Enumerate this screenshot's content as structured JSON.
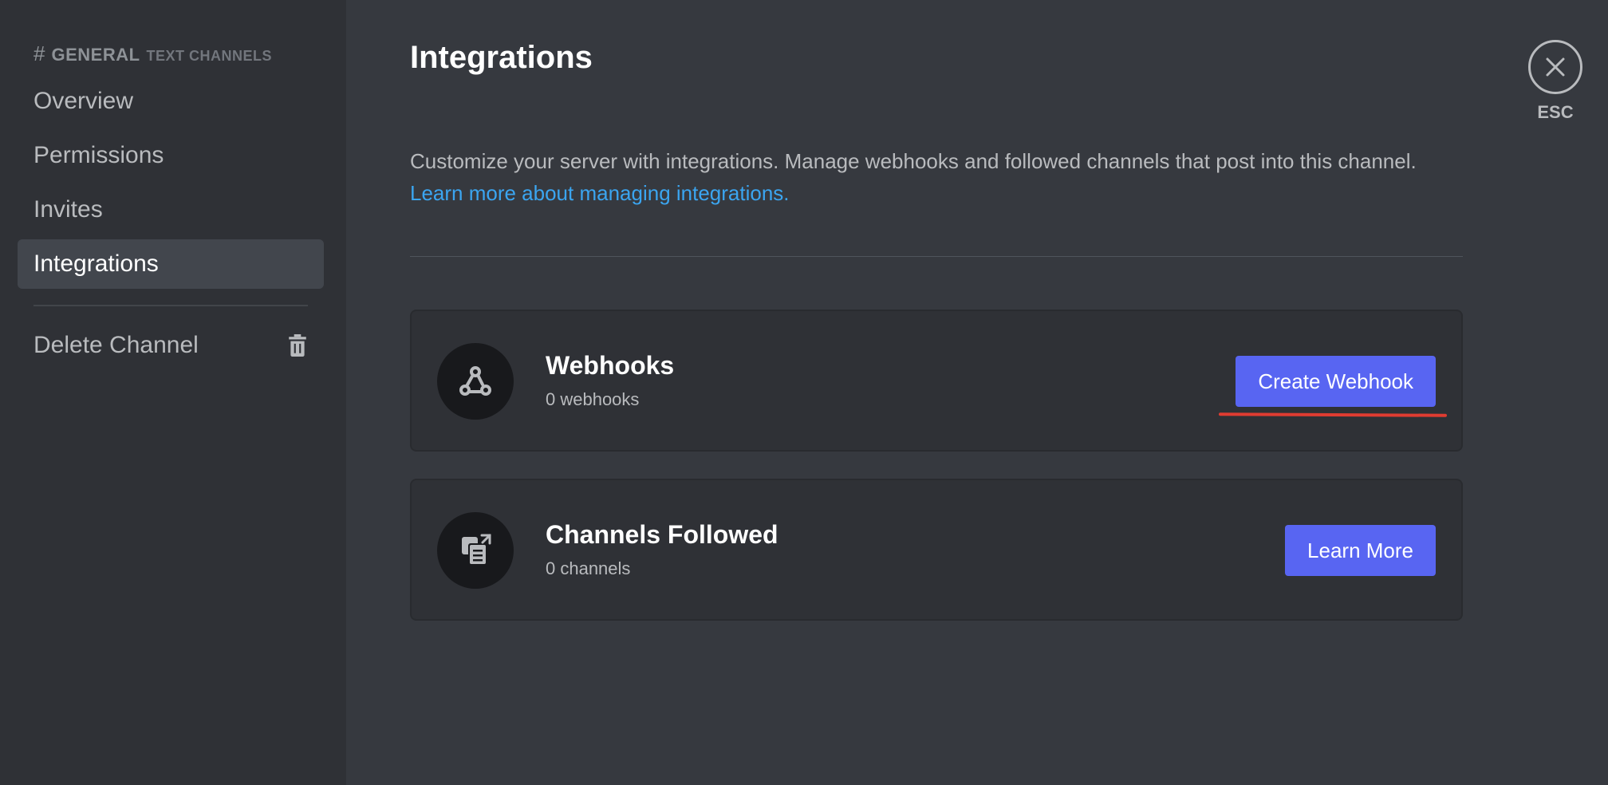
{
  "sidebar": {
    "channel_header": {
      "hash": "#",
      "name": "GENERAL",
      "category": "TEXT CHANNELS"
    },
    "items": [
      {
        "label": "Overview"
      },
      {
        "label": "Permissions"
      },
      {
        "label": "Invites"
      },
      {
        "label": "Integrations",
        "active": true
      }
    ],
    "delete_channel_label": "Delete Channel"
  },
  "main": {
    "title": "Integrations",
    "description": "Customize your server with integrations. Manage webhooks and followed channels that post into this channel.",
    "learn_more_link": "Learn more about managing integrations.",
    "cards": [
      {
        "title": "Webhooks",
        "subtitle": "0 webhooks",
        "button_label": "Create Webhook",
        "icon": "webhook-icon"
      },
      {
        "title": "Channels Followed",
        "subtitle": "0 channels",
        "button_label": "Learn More",
        "icon": "channels-followed-icon"
      }
    ]
  },
  "close": {
    "label": "ESC"
  },
  "colors": {
    "accent": "#5865f2",
    "link": "#3ba5f0",
    "annotation": "#e03c31"
  }
}
